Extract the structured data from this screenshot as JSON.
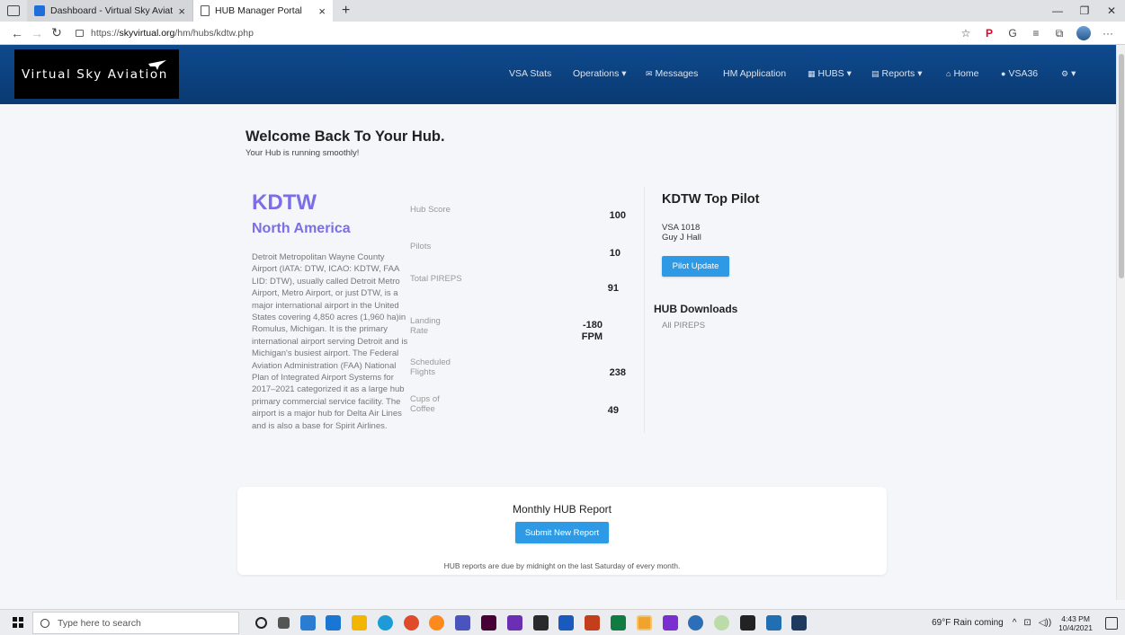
{
  "browser": {
    "tabs": [
      {
        "title": "Dashboard - Virtual Sky Aviation",
        "close": "×"
      },
      {
        "title": "HUB Manager Portal",
        "close": "×"
      }
    ],
    "new_tab": "+",
    "url_prefix": "https://",
    "url_host": "skyvirtual.org",
    "url_path": "/hm/hubs/kdtw.php"
  },
  "site": {
    "logo_text": "Virtual Sky Aviation",
    "nav": [
      {
        "label": "VSA Stats"
      },
      {
        "label": "Operations ▾"
      },
      {
        "label": "Messages",
        "icon": "✉"
      },
      {
        "label": "HM Application"
      },
      {
        "label": "HUBS ▾",
        "icon": "▦"
      },
      {
        "label": "Reports ▾",
        "icon": "▤"
      },
      {
        "label": "Home",
        "icon": "⌂"
      },
      {
        "label": "VSA36",
        "icon": "●"
      },
      {
        "label": "▾",
        "icon": "⚙"
      }
    ]
  },
  "page": {
    "heading": "Welcome Back To Your Hub.",
    "subheading": "Your Hub is running smoothly!"
  },
  "hub": {
    "code": "KDTW",
    "region": "North America",
    "description": "Detroit Metropolitan Wayne County Airport (IATA: DTW, ICAO: KDTW, FAA LID: DTW), usually called Detroit Metro Airport, Metro Airport, or just DTW, is a major international airport in the United States covering 4,850 acres (1,960 ha)in Romulus, Michigan. It is the primary international airport serving Detroit and is Michigan's busiest airport. The Federal Aviation Administration (FAA) National Plan of Integrated Airport Systems for 2017–2021 categorized it as a large hub primary commercial service facility. The airport is a major hub for Delta Air Lines and is also a base for Spirit Airlines.",
    "stats": [
      {
        "label": "Hub Score",
        "value": "100"
      },
      {
        "label": "Pilots",
        "value": "10"
      },
      {
        "label": "Total PIREPS",
        "value": "91"
      },
      {
        "label": "Landing Rate",
        "value": "-180 FPM"
      },
      {
        "label": "Scheduled Flights",
        "value": "238"
      },
      {
        "label": "Cups of Coffee",
        "value": "49"
      }
    ]
  },
  "top_pilot": {
    "title": "KDTW Top Pilot",
    "id": "VSA 1018",
    "name": "Guy J Hall",
    "button": "Pilot Update"
  },
  "downloads": {
    "title": "HUB Downloads",
    "link": "All PIREPS"
  },
  "report": {
    "title": "Monthly HUB Report",
    "button": "Submit New Report",
    "note": "HUB reports are due by midnight on the last Saturday of every month."
  },
  "taskbar": {
    "search_placeholder": "Type here to search",
    "weather": "69°F  Rain coming",
    "time": "4:43 PM",
    "date": "10/4/2021"
  },
  "colors": {
    "accent": "#7b6ee6",
    "button": "#2e9ae6",
    "navbar": "#0e4a8e"
  }
}
